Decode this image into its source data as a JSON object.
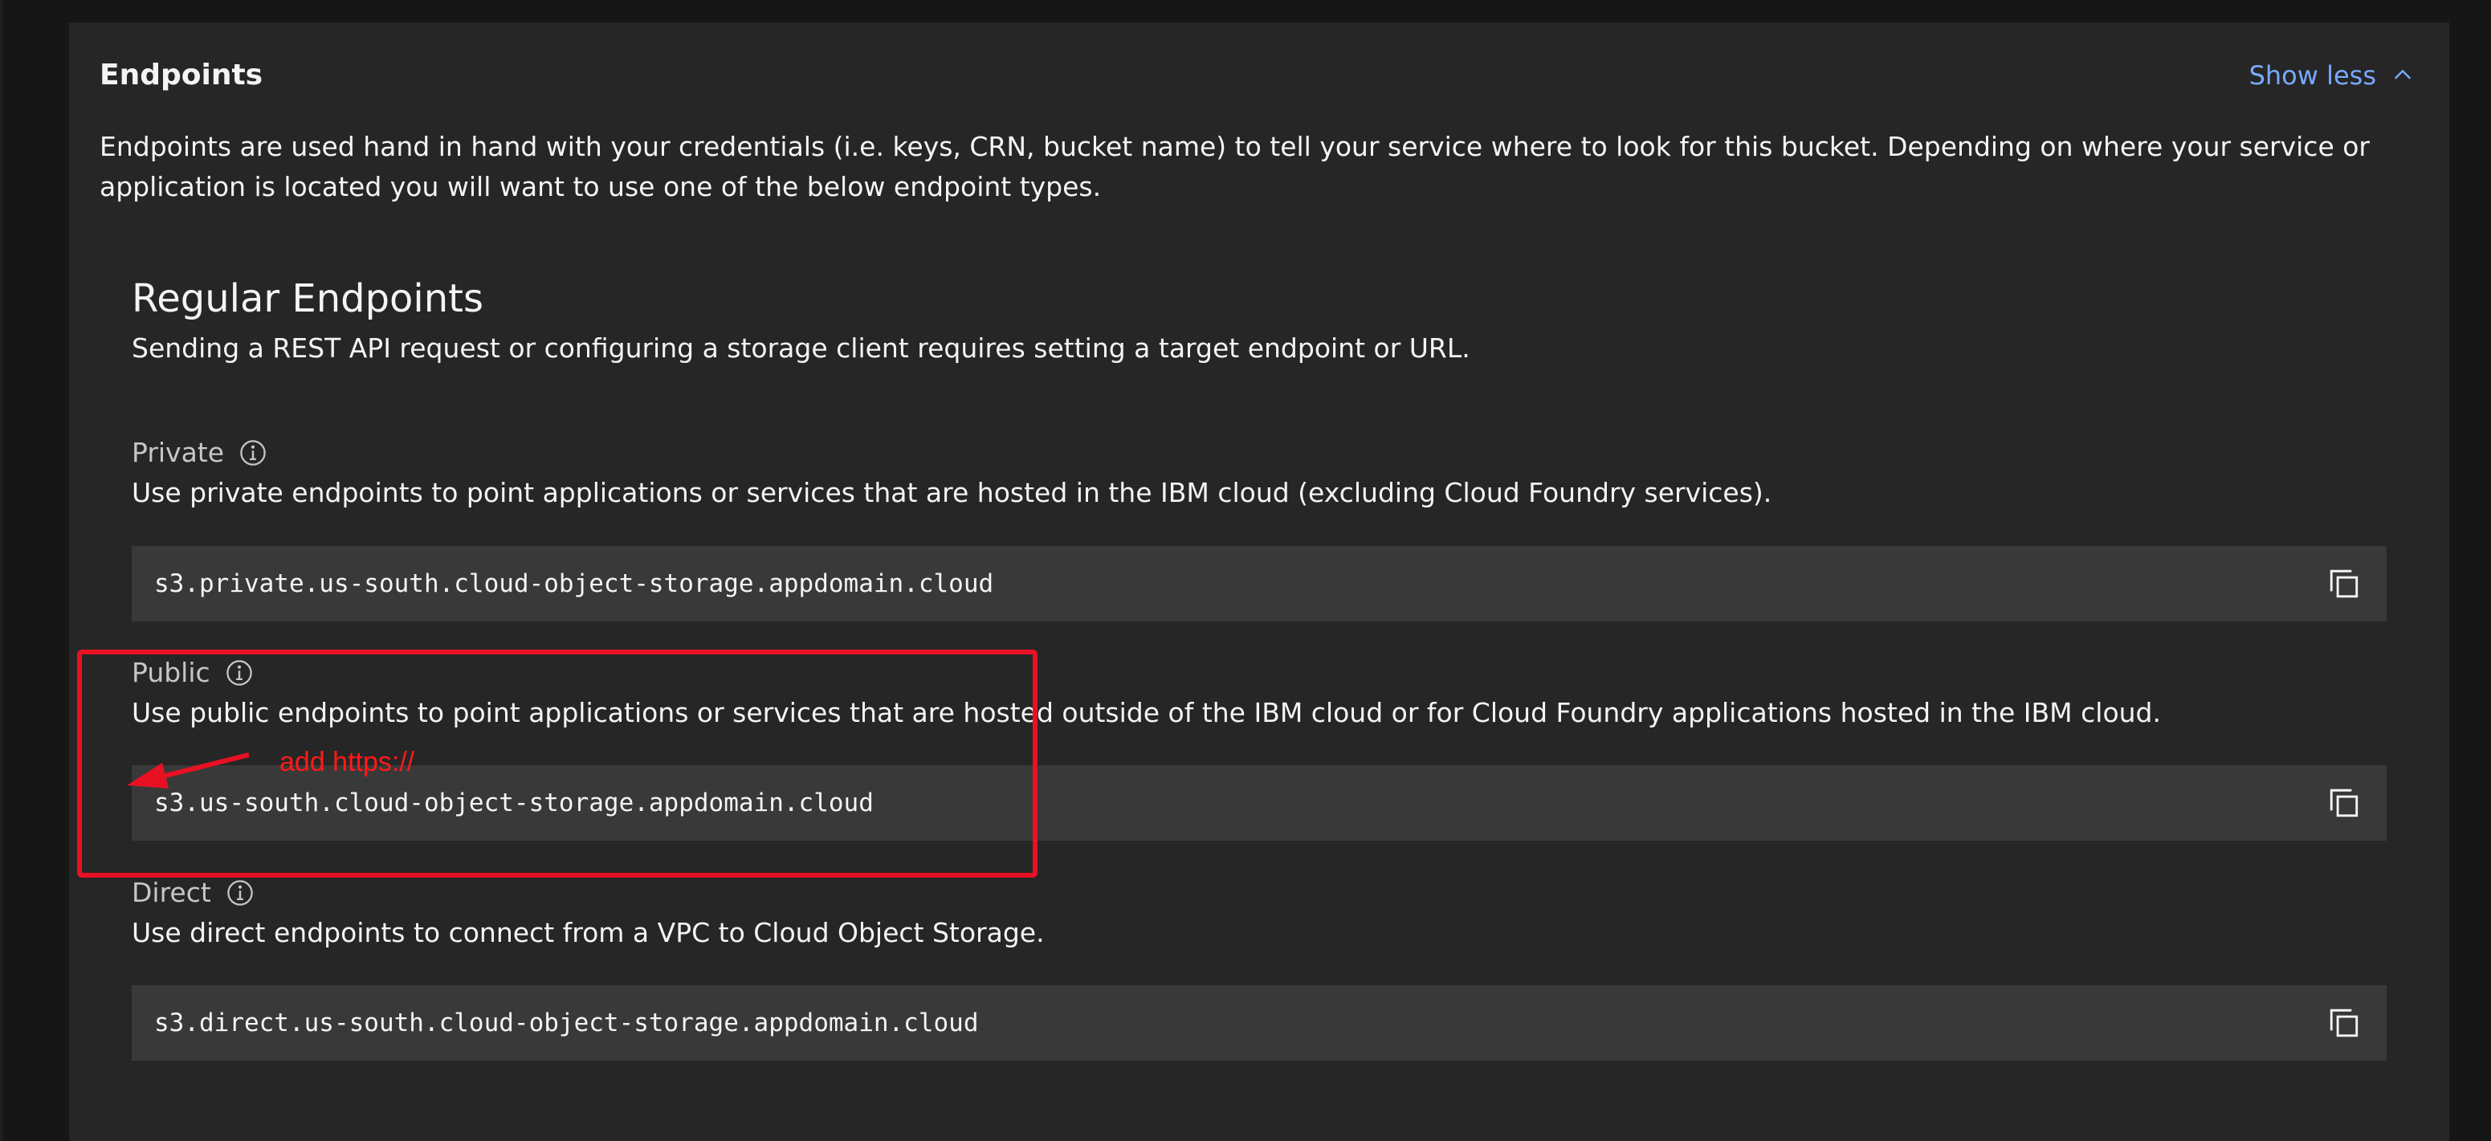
{
  "panel": {
    "title": "Endpoints",
    "toggle_label": "Show less",
    "toggle_icon": "chevron-up-icon",
    "intro": "Endpoints are used hand in hand with your credentials (i.e. keys, CRN, bucket name) to tell your service where to look for this bucket. Depending on where your service or application is located you will want to use one of the below endpoint types."
  },
  "regular": {
    "title": "Regular Endpoints",
    "description": "Sending a REST API request or configuring a storage client requires setting a target endpoint or URL."
  },
  "endpoints": [
    {
      "label": "Private",
      "info_icon": "info-icon",
      "description": "Use private endpoints to point applications or services that are hosted in the IBM cloud (excluding Cloud Foundry services).",
      "url": "s3.private.us-south.cloud-object-storage.appdomain.cloud",
      "copy_icon": "copy-icon"
    },
    {
      "label": "Public",
      "info_icon": "info-icon",
      "description": "Use public endpoints to point applications or services that are hosted outside of the IBM cloud or for Cloud Foundry applications hosted in the IBM cloud.",
      "url": "s3.us-south.cloud-object-storage.appdomain.cloud",
      "copy_icon": "copy-icon"
    },
    {
      "label": "Direct",
      "info_icon": "info-icon",
      "description": "Use direct endpoints to connect from a VPC to Cloud Object Storage.",
      "url": "s3.direct.us-south.cloud-object-storage.appdomain.cloud",
      "copy_icon": "copy-icon"
    }
  ],
  "annotation": {
    "text": "add https://",
    "color": "#e81123"
  },
  "colors": {
    "page_bg": "#161616",
    "panel_bg": "#262626",
    "code_bg": "#393939",
    "link": "#78a9ff",
    "text": "#f4f4f4",
    "label": "#c6c6c6"
  }
}
